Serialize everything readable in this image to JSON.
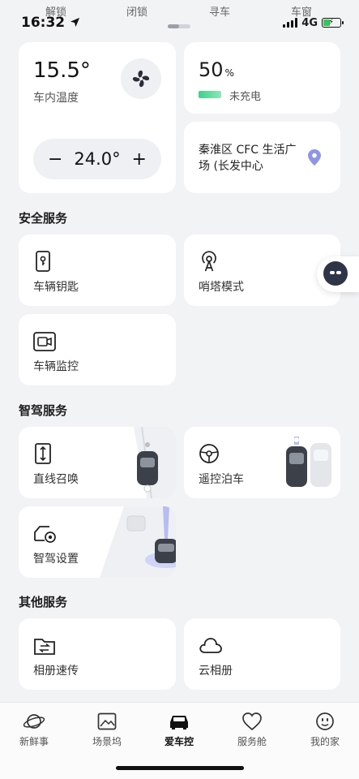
{
  "quick_actions": [
    "解锁",
    "闭锁",
    "寻车",
    "车窗"
  ],
  "status_bar": {
    "time": "16:32",
    "network": "4G"
  },
  "climate": {
    "interior_temp": "15.5°",
    "interior_label": "车内温度",
    "set_temp": "24.0°",
    "minus": "−",
    "plus": "+",
    "fan_icon": "fan-icon"
  },
  "battery": {
    "percent": "50",
    "unit": "%",
    "status": "未充电",
    "level": 0.5
  },
  "location": {
    "address": "秦淮区 CFC 生活广场 (长发中心"
  },
  "sections": {
    "safety": "安全服务",
    "driving": "智驾服务",
    "other": "其他服务"
  },
  "safety_services": [
    {
      "label": "车辆钥匙",
      "icon": "phone-key-icon"
    },
    {
      "label": "哨塔模式",
      "icon": "sentry-tower-icon"
    },
    {
      "label": "车辆监控",
      "icon": "camera-monitor-icon"
    }
  ],
  "driving_services": [
    {
      "label": "直线召唤",
      "icon": "straight-summon-icon"
    },
    {
      "label": "遥控泊车",
      "icon": "steering-wheel-icon"
    },
    {
      "label": "智驾设置",
      "icon": "car-settings-icon"
    }
  ],
  "other_services": [
    {
      "label": "相册速传",
      "icon": "folder-transfer-icon"
    },
    {
      "label": "云相册",
      "icon": "cloud-icon"
    }
  ],
  "tabs": [
    {
      "label": "新鲜事",
      "icon": "planet-icon"
    },
    {
      "label": "场景坞",
      "icon": "picture-icon"
    },
    {
      "label": "爱车控",
      "icon": "car-icon"
    },
    {
      "label": "服务舱",
      "icon": "heart-icon"
    },
    {
      "label": "我的家",
      "icon": "face-icon"
    }
  ],
  "colors": {
    "background": "#f2f3f5",
    "card": "#ffffff",
    "battery_green": "#3ed08a",
    "location_pin": "#8f95e6"
  }
}
